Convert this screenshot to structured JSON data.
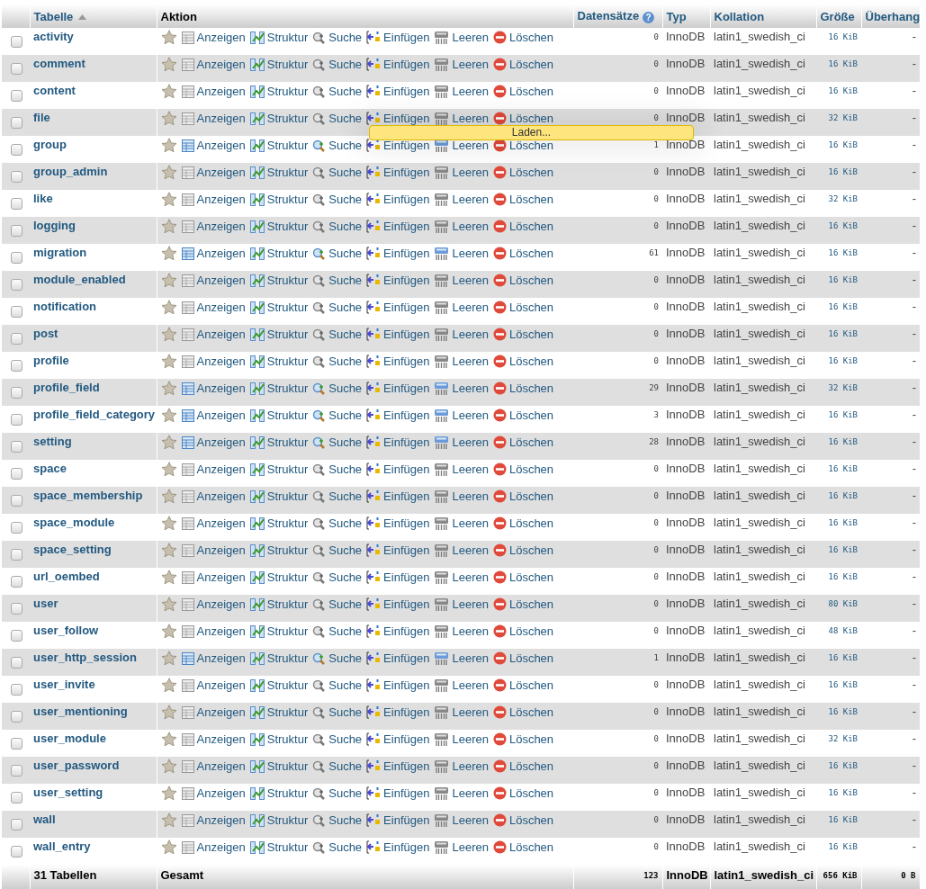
{
  "table": {
    "columns": [
      {
        "label": "Tabelle",
        "sorted": true
      },
      {
        "label": "Aktion"
      },
      {
        "label": "Datensätze",
        "help": "?"
      },
      {
        "label": "Typ"
      },
      {
        "label": "Kollation"
      },
      {
        "label": "Größe"
      },
      {
        "label": "Überhang"
      }
    ],
    "rows": [
      {
        "name": "activity",
        "checked": false,
        "empty": true,
        "actions": [
          "Anzeigen",
          "Struktur",
          "Suche",
          "Einfügen",
          "Leeren",
          "Löschen"
        ],
        "records": "0",
        "engine": "InnoDB",
        "collation": "latin1_swedish_ci",
        "size": "16 KiB",
        "overhead": "-"
      },
      {
        "name": "comment",
        "checked": false,
        "empty": true,
        "actions": [
          "Anzeigen",
          "Struktur",
          "Suche",
          "Einfügen",
          "Leeren",
          "Löschen"
        ],
        "records": "0",
        "engine": "InnoDB",
        "collation": "latin1_swedish_ci",
        "size": "16 KiB",
        "overhead": "-"
      },
      {
        "name": "content",
        "checked": false,
        "empty": true,
        "actions": [
          "Anzeigen",
          "Struktur",
          "Suche",
          "Einfügen",
          "Leeren",
          "Löschen"
        ],
        "records": "0",
        "engine": "InnoDB",
        "collation": "latin1_swedish_ci",
        "size": "16 KiB",
        "overhead": "-"
      },
      {
        "name": "file",
        "checked": false,
        "empty": true,
        "actions": [
          "Anzeigen",
          "Struktur",
          "Suche",
          "Einfügen",
          "Leeren",
          "Löschen"
        ],
        "records": "0",
        "engine": "InnoDB",
        "collation": "latin1_swedish_ci",
        "size": "32 KiB",
        "overhead": "-"
      },
      {
        "name": "group",
        "checked": false,
        "empty": false,
        "actions": [
          "Anzeigen",
          "Struktur",
          "Suche",
          "Einfügen",
          "Leeren",
          "Löschen"
        ],
        "records": "1",
        "engine": "InnoDB",
        "collation": "latin1_swedish_ci",
        "size": "16 KiB",
        "overhead": "-"
      },
      {
        "name": "group_admin",
        "checked": false,
        "empty": true,
        "actions": [
          "Anzeigen",
          "Struktur",
          "Suche",
          "Einfügen",
          "Leeren",
          "Löschen"
        ],
        "records": "0",
        "engine": "InnoDB",
        "collation": "latin1_swedish_ci",
        "size": "16 KiB",
        "overhead": "-"
      },
      {
        "name": "like",
        "checked": false,
        "empty": true,
        "actions": [
          "Anzeigen",
          "Struktur",
          "Suche",
          "Einfügen",
          "Leeren",
          "Löschen"
        ],
        "records": "0",
        "engine": "InnoDB",
        "collation": "latin1_swedish_ci",
        "size": "32 KiB",
        "overhead": "-"
      },
      {
        "name": "logging",
        "checked": false,
        "empty": true,
        "actions": [
          "Anzeigen",
          "Struktur",
          "Suche",
          "Einfügen",
          "Leeren",
          "Löschen"
        ],
        "records": "0",
        "engine": "InnoDB",
        "collation": "latin1_swedish_ci",
        "size": "16 KiB",
        "overhead": "-"
      },
      {
        "name": "migration",
        "checked": false,
        "empty": false,
        "actions": [
          "Anzeigen",
          "Struktur",
          "Suche",
          "Einfügen",
          "Leeren",
          "Löschen"
        ],
        "records": "61",
        "engine": "InnoDB",
        "collation": "latin1_swedish_ci",
        "size": "16 KiB",
        "overhead": "-"
      },
      {
        "name": "module_enabled",
        "checked": false,
        "empty": true,
        "actions": [
          "Anzeigen",
          "Struktur",
          "Suche",
          "Einfügen",
          "Leeren",
          "Löschen"
        ],
        "records": "0",
        "engine": "InnoDB",
        "collation": "latin1_swedish_ci",
        "size": "16 KiB",
        "overhead": "-"
      },
      {
        "name": "notification",
        "checked": false,
        "empty": true,
        "actions": [
          "Anzeigen",
          "Struktur",
          "Suche",
          "Einfügen",
          "Leeren",
          "Löschen"
        ],
        "records": "0",
        "engine": "InnoDB",
        "collation": "latin1_swedish_ci",
        "size": "16 KiB",
        "overhead": "-"
      },
      {
        "name": "post",
        "checked": false,
        "empty": true,
        "actions": [
          "Anzeigen",
          "Struktur",
          "Suche",
          "Einfügen",
          "Leeren",
          "Löschen"
        ],
        "records": "0",
        "engine": "InnoDB",
        "collation": "latin1_swedish_ci",
        "size": "16 KiB",
        "overhead": "-"
      },
      {
        "name": "profile",
        "checked": false,
        "empty": true,
        "actions": [
          "Anzeigen",
          "Struktur",
          "Suche",
          "Einfügen",
          "Leeren",
          "Löschen"
        ],
        "records": "0",
        "engine": "InnoDB",
        "collation": "latin1_swedish_ci",
        "size": "16 KiB",
        "overhead": "-"
      },
      {
        "name": "profile_field",
        "checked": false,
        "empty": false,
        "actions": [
          "Anzeigen",
          "Struktur",
          "Suche",
          "Einfügen",
          "Leeren",
          "Löschen"
        ],
        "records": "29",
        "engine": "InnoDB",
        "collation": "latin1_swedish_ci",
        "size": "32 KiB",
        "overhead": "-"
      },
      {
        "name": "profile_field_category",
        "checked": false,
        "empty": false,
        "actions": [
          "Anzeigen",
          "Struktur",
          "Suche",
          "Einfügen",
          "Leeren",
          "Löschen"
        ],
        "records": "3",
        "engine": "InnoDB",
        "collation": "latin1_swedish_ci",
        "size": "16 KiB",
        "overhead": "-"
      },
      {
        "name": "setting",
        "checked": false,
        "empty": false,
        "actions": [
          "Anzeigen",
          "Struktur",
          "Suche",
          "Einfügen",
          "Leeren",
          "Löschen"
        ],
        "records": "28",
        "engine": "InnoDB",
        "collation": "latin1_swedish_ci",
        "size": "16 KiB",
        "overhead": "-"
      },
      {
        "name": "space",
        "checked": false,
        "empty": true,
        "actions": [
          "Anzeigen",
          "Struktur",
          "Suche",
          "Einfügen",
          "Leeren",
          "Löschen"
        ],
        "records": "0",
        "engine": "InnoDB",
        "collation": "latin1_swedish_ci",
        "size": "16 KiB",
        "overhead": "-"
      },
      {
        "name": "space_membership",
        "checked": false,
        "empty": true,
        "actions": [
          "Anzeigen",
          "Struktur",
          "Suche",
          "Einfügen",
          "Leeren",
          "Löschen"
        ],
        "records": "0",
        "engine": "InnoDB",
        "collation": "latin1_swedish_ci",
        "size": "16 KiB",
        "overhead": "-"
      },
      {
        "name": "space_module",
        "checked": false,
        "empty": true,
        "actions": [
          "Anzeigen",
          "Struktur",
          "Suche",
          "Einfügen",
          "Leeren",
          "Löschen"
        ],
        "records": "0",
        "engine": "InnoDB",
        "collation": "latin1_swedish_ci",
        "size": "16 KiB",
        "overhead": "-"
      },
      {
        "name": "space_setting",
        "checked": false,
        "empty": true,
        "actions": [
          "Anzeigen",
          "Struktur",
          "Suche",
          "Einfügen",
          "Leeren",
          "Löschen"
        ],
        "records": "0",
        "engine": "InnoDB",
        "collation": "latin1_swedish_ci",
        "size": "16 KiB",
        "overhead": "-"
      },
      {
        "name": "url_oembed",
        "checked": false,
        "empty": true,
        "actions": [
          "Anzeigen",
          "Struktur",
          "Suche",
          "Einfügen",
          "Leeren",
          "Löschen"
        ],
        "records": "0",
        "engine": "InnoDB",
        "collation": "latin1_swedish_ci",
        "size": "16 KiB",
        "overhead": "-"
      },
      {
        "name": "user",
        "checked": false,
        "empty": true,
        "actions": [
          "Anzeigen",
          "Struktur",
          "Suche",
          "Einfügen",
          "Leeren",
          "Löschen"
        ],
        "records": "0",
        "engine": "InnoDB",
        "collation": "latin1_swedish_ci",
        "size": "80 KiB",
        "overhead": "-"
      },
      {
        "name": "user_follow",
        "checked": false,
        "empty": true,
        "actions": [
          "Anzeigen",
          "Struktur",
          "Suche",
          "Einfügen",
          "Leeren",
          "Löschen"
        ],
        "records": "0",
        "engine": "InnoDB",
        "collation": "latin1_swedish_ci",
        "size": "48 KiB",
        "overhead": "-"
      },
      {
        "name": "user_http_session",
        "checked": false,
        "empty": false,
        "actions": [
          "Anzeigen",
          "Struktur",
          "Suche",
          "Einfügen",
          "Leeren",
          "Löschen"
        ],
        "records": "1",
        "engine": "InnoDB",
        "collation": "latin1_swedish_ci",
        "size": "16 KiB",
        "overhead": "-"
      },
      {
        "name": "user_invite",
        "checked": false,
        "empty": true,
        "actions": [
          "Anzeigen",
          "Struktur",
          "Suche",
          "Einfügen",
          "Leeren",
          "Löschen"
        ],
        "records": "0",
        "engine": "InnoDB",
        "collation": "latin1_swedish_ci",
        "size": "16 KiB",
        "overhead": "-"
      },
      {
        "name": "user_mentioning",
        "checked": false,
        "empty": true,
        "actions": [
          "Anzeigen",
          "Struktur",
          "Suche",
          "Einfügen",
          "Leeren",
          "Löschen"
        ],
        "records": "0",
        "engine": "InnoDB",
        "collation": "latin1_swedish_ci",
        "size": "16 KiB",
        "overhead": "-"
      },
      {
        "name": "user_module",
        "checked": false,
        "empty": true,
        "actions": [
          "Anzeigen",
          "Struktur",
          "Suche",
          "Einfügen",
          "Leeren",
          "Löschen"
        ],
        "records": "0",
        "engine": "InnoDB",
        "collation": "latin1_swedish_ci",
        "size": "32 KiB",
        "overhead": "-"
      },
      {
        "name": "user_password",
        "checked": false,
        "empty": true,
        "actions": [
          "Anzeigen",
          "Struktur",
          "Suche",
          "Einfügen",
          "Leeren",
          "Löschen"
        ],
        "records": "0",
        "engine": "InnoDB",
        "collation": "latin1_swedish_ci",
        "size": "16 KiB",
        "overhead": "-"
      },
      {
        "name": "user_setting",
        "checked": false,
        "empty": true,
        "actions": [
          "Anzeigen",
          "Struktur",
          "Suche",
          "Einfügen",
          "Leeren",
          "Löschen"
        ],
        "records": "0",
        "engine": "InnoDB",
        "collation": "latin1_swedish_ci",
        "size": "16 KiB",
        "overhead": "-"
      },
      {
        "name": "wall",
        "checked": false,
        "empty": true,
        "actions": [
          "Anzeigen",
          "Struktur",
          "Suche",
          "Einfügen",
          "Leeren",
          "Löschen"
        ],
        "records": "0",
        "engine": "InnoDB",
        "collation": "latin1_swedish_ci",
        "size": "16 KiB",
        "overhead": "-"
      },
      {
        "name": "wall_entry",
        "checked": false,
        "empty": true,
        "actions": [
          "Anzeigen",
          "Struktur",
          "Suche",
          "Einfügen",
          "Leeren",
          "Löschen"
        ],
        "records": "0",
        "engine": "InnoDB",
        "collation": "latin1_swedish_ci",
        "size": "16 KiB",
        "overhead": "-"
      }
    ],
    "footer": {
      "count": "31 Tabellen",
      "label": "Gesamt",
      "records": "123",
      "engine": "InnoDB",
      "collation": "latin1_swedish_ci",
      "size": "656 KiB",
      "overhead": "0 B"
    }
  },
  "loading": {
    "text": "Laden..."
  }
}
